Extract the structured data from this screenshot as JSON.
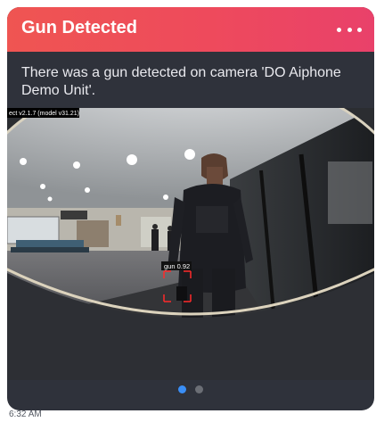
{
  "notification": {
    "title": "Gun Detected",
    "more_icon": "more-horizontal-icon",
    "message": "There was a gun detected on camera 'DO Aiphone Demo Unit'."
  },
  "camera": {
    "overlay_label": "ect v2.1.7 (model v31.21)",
    "detection_label": "gun 0.92",
    "detection_color": "#ff2a2a"
  },
  "pager": {
    "pages": 2,
    "active": 1,
    "active_color": "#3a8ef6"
  },
  "timestamp": "6:32 AM",
  "colors": {
    "header_start": "#ef5552",
    "header_end": "#e9416a",
    "card_bg": "#2f323b"
  }
}
